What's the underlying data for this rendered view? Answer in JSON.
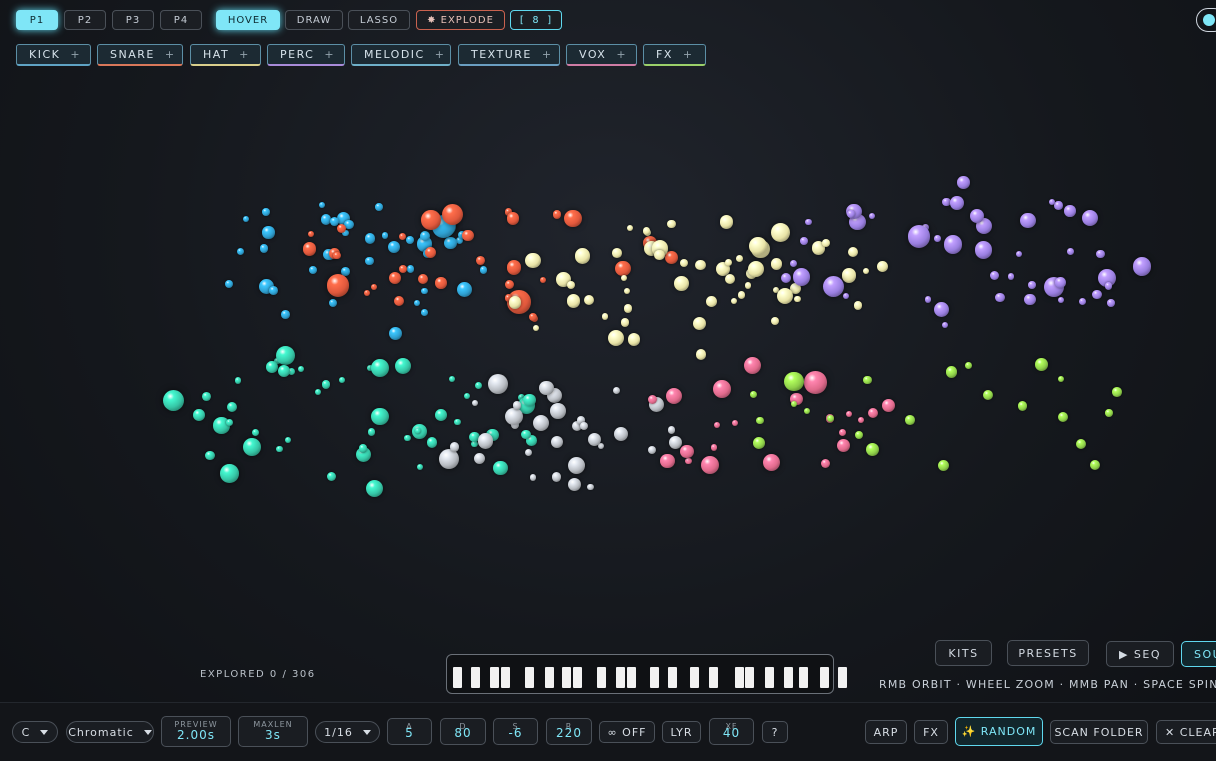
{
  "pages": [
    "P1",
    "P2",
    "P3",
    "P4"
  ],
  "modes": [
    "HOVER",
    "DRAW",
    "LASSO"
  ],
  "explode_label": "✸ EXPLODE",
  "count_label": "[ 8 ]",
  "categories": [
    {
      "label": "KICK",
      "color": "#5fa3c4"
    },
    {
      "label": "SNARE",
      "color": "#d9785a"
    },
    {
      "label": "HAT",
      "color": "#d9cf8c"
    },
    {
      "label": "PERC",
      "color": "#a88bd9"
    },
    {
      "label": "MELODIC",
      "color": "#6fb0c9"
    },
    {
      "label": "TEXTURE",
      "color": "#6a9ec1"
    },
    {
      "label": "VOX",
      "color": "#cf7ca5"
    },
    {
      "label": "FX",
      "color": "#9bd06a"
    }
  ],
  "category_plus": "+",
  "status": "EXPLORED 0 / 306",
  "side_buttons": {
    "kits": "KITS",
    "presets": "PRESETS",
    "seq": "▶ SEQ",
    "sounds": "SOU"
  },
  "hint": "RMB ORBIT · WHEEL ZOOM · MMB PAN · SPACE SPIN · R",
  "bottom": {
    "key": "C",
    "scale": "Chromatic",
    "preview_label": "PREVIEW",
    "preview_value": "2.00s",
    "maxlen_label": "MAXLEN",
    "maxlen_value": "3s",
    "division": "1/16",
    "a_label": "A",
    "a_value": "5",
    "d_label": "D",
    "d_value": "80",
    "s_label": "S",
    "s_value": "-6",
    "r_label": "R",
    "r_value": "220",
    "loop": "∞ OFF",
    "lyr": "LYR",
    "xf_label": "XF",
    "xf_value": "40",
    "help": "?",
    "arp": "ARP",
    "fx": "FX",
    "random": "✨ RANDOM",
    "scan": "SCAN FOLDER",
    "clear": "✕ CLEAR"
  },
  "sphere_colors": {
    "kick": "#2f9fd0",
    "snare": "#e0583c",
    "hat": "#e8e3a6",
    "perc": "#9a7fe0",
    "melodic": "#36c6a6",
    "texture": "#b8bcc2",
    "vox": "#e06a8c",
    "fx": "#8fd04a"
  }
}
